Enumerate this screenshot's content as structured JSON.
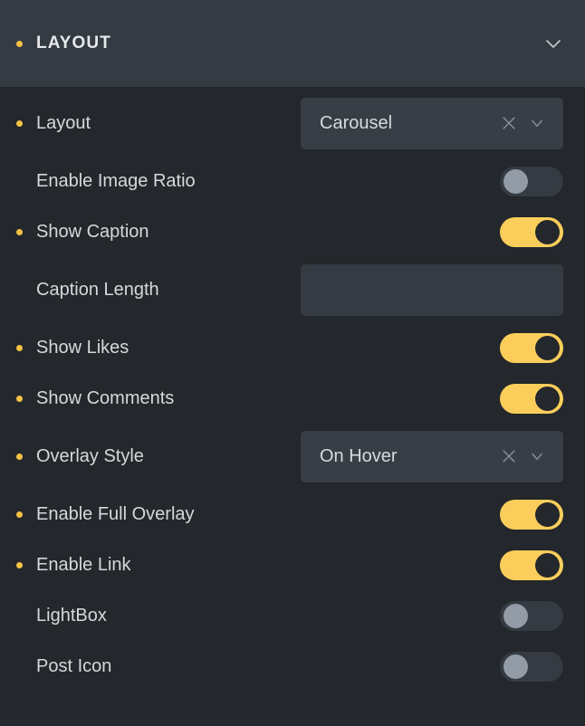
{
  "section": {
    "title": "LAYOUT",
    "has_dot": true,
    "collapse_icon": "chevron-down-icon",
    "accent_color": "#f5c344",
    "header_bg": "#343b43",
    "body_bg": "#24272b"
  },
  "rows": [
    {
      "label": "Layout",
      "has_dot": true,
      "control": "select",
      "value": "Carousel",
      "clear_icon": "close-icon",
      "chevron_icon": "chevron-down-icon"
    },
    {
      "label": "Enable Image Ratio",
      "has_dot": false,
      "control": "toggle",
      "state": "off"
    },
    {
      "label": "Show Caption",
      "has_dot": true,
      "control": "toggle",
      "state": "on"
    },
    {
      "label": "Caption Length",
      "has_dot": false,
      "control": "input",
      "value": "",
      "placeholder": ""
    },
    {
      "label": "Show Likes",
      "has_dot": true,
      "control": "toggle",
      "state": "on"
    },
    {
      "label": "Show Comments",
      "has_dot": true,
      "control": "toggle",
      "state": "on"
    },
    {
      "label": "Overlay Style",
      "has_dot": true,
      "control": "select",
      "value": "On Hover",
      "clear_icon": "close-icon",
      "chevron_icon": "chevron-down-icon"
    },
    {
      "label": "Enable Full Overlay",
      "has_dot": true,
      "control": "toggle",
      "state": "on"
    },
    {
      "label": "Enable Link",
      "has_dot": true,
      "control": "toggle",
      "state": "on"
    },
    {
      "label": "LightBox",
      "has_dot": false,
      "control": "toggle",
      "state": "off"
    },
    {
      "label": "Post Icon",
      "has_dot": false,
      "control": "toggle",
      "state": "off"
    }
  ]
}
